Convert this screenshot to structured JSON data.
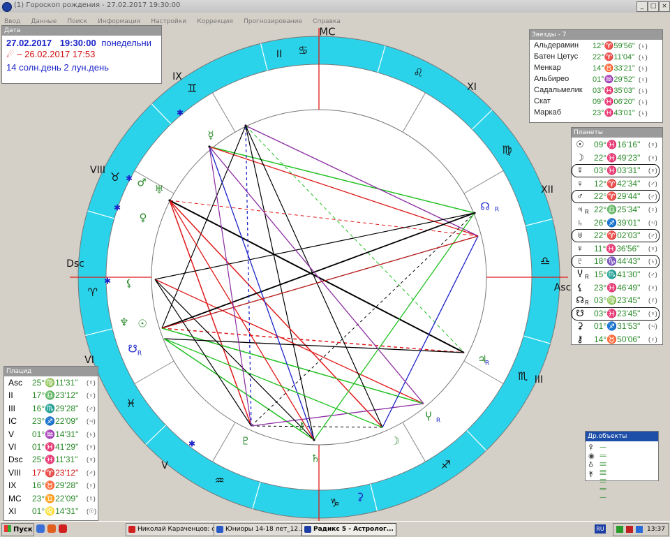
{
  "window": {
    "title": "(1) Гороскоп рождения - 27.02.2017  19:30:00",
    "minimize": "_",
    "maximize": "□",
    "close": "×"
  },
  "menu": [
    "Ввод",
    "Данные",
    "Поиск",
    "Информация",
    "Настройки",
    "Коррекция",
    "Прогнозирование",
    "Справка"
  ],
  "date_panel": {
    "header": "Дата",
    "date": "27.02.2017",
    "time": "19:30:00",
    "weekday": "понедельни",
    "progression_icon": "comet-icon",
    "progression": "– 26.02.2017  17:53",
    "days": "14 солн.день 2 лун.день"
  },
  "stars": {
    "header": "Звезды - 7",
    "items": [
      {
        "name": "Альдерамин",
        "value": "12°♈59'56\"",
        "ruler": "(♄)"
      },
      {
        "name": "Батен Цетус",
        "value": "22°♈11'04\"",
        "ruler": "(♄)"
      },
      {
        "name": "Менкар",
        "value": "14°♉33'21\"",
        "ruler": "(♄)"
      },
      {
        "name": "Альбирео",
        "value": "01°♒29'52\"",
        "ruler": "(♀)"
      },
      {
        "name": "Садальмелик",
        "value": "03°♓35'03\"",
        "ruler": "(♄)"
      },
      {
        "name": "Скат",
        "value": "09°♓06'20\"",
        "ruler": "(♄)"
      },
      {
        "name": "Маркаб",
        "value": "23°♓43'01\"",
        "ruler": "(♄)"
      }
    ]
  },
  "planets": {
    "header": "Планеты",
    "items": [
      {
        "glyph": "☉",
        "value": "09°♓16'16\"",
        "ruler": "(♆)",
        "retro": "",
        "boxed": false,
        "red": false
      },
      {
        "glyph": "☽",
        "value": "22°♓49'23\"",
        "ruler": "(♆)",
        "retro": "",
        "boxed": false,
        "red": false
      },
      {
        "glyph": "☿",
        "value": "03°♓03'31\"",
        "ruler": "(♆)",
        "retro": "",
        "boxed": true,
        "red": false
      },
      {
        "glyph": "♀",
        "value": "12°♈42'34\"",
        "ruler": "(♂)",
        "retro": "",
        "boxed": false,
        "red": false
      },
      {
        "glyph": "♂",
        "value": "22°♈29'44\"",
        "ruler": "(♂)",
        "retro": "",
        "boxed": true,
        "red": false
      },
      {
        "glyph": "♃",
        "value": "22°♎25'34\"",
        "ruler": "(♀)",
        "retro": "R",
        "boxed": false,
        "red": false
      },
      {
        "glyph": "♄",
        "value": "26°♐39'01\"",
        "ruler": "(♃)",
        "retro": "",
        "boxed": false,
        "red": false
      },
      {
        "glyph": "♅",
        "value": "22°♈02'03\"",
        "ruler": "(♂)",
        "retro": "",
        "boxed": true,
        "red": false
      },
      {
        "glyph": "♆",
        "value": "11°♓36'56\"",
        "ruler": "(♆)",
        "retro": "",
        "boxed": false,
        "red": false
      },
      {
        "glyph": "♇",
        "value": "18°♑44'43\"",
        "ruler": "(♄)",
        "retro": "",
        "boxed": true,
        "red": false
      },
      {
        "glyph": "Ⴤ",
        "value": "15°♏41'30\"",
        "ruler": "(♂)",
        "retro": "R",
        "boxed": false,
        "red": false
      },
      {
        "glyph": "⚸",
        "value": "23°♓46'49\"",
        "ruler": "(♆)",
        "retro": "",
        "boxed": false,
        "red": false
      },
      {
        "glyph": "☊",
        "value": "03°♍23'45\"",
        "ruler": "(☿)",
        "retro": "R",
        "boxed": false,
        "red": false
      },
      {
        "glyph": "☋",
        "value": "03°♓23'45\"",
        "ruler": "(♆)",
        "retro": "",
        "boxed": true,
        "red": false
      },
      {
        "glyph": "⚳",
        "value": "01°♐31'53\"",
        "ruler": "(♃)",
        "retro": "",
        "boxed": false,
        "red": false
      },
      {
        "glyph": "⚷",
        "value": "14°♉50'06\"",
        "ruler": "(♀)",
        "retro": "",
        "boxed": false,
        "red": false
      }
    ]
  },
  "houses": {
    "header": "Плацид",
    "items": [
      {
        "key": "Asc",
        "value": "25°♍11'31\"",
        "ruler": "(☿)",
        "red": false
      },
      {
        "key": "II",
        "value": "17°♎23'12\"",
        "ruler": "(♀)",
        "red": false
      },
      {
        "key": "III",
        "value": "16°♏29'28\"",
        "ruler": "(♂)",
        "red": false
      },
      {
        "key": "IC",
        "value": "23°♐22'09\"",
        "ruler": "(♃)",
        "red": false
      },
      {
        "key": "V",
        "value": "01°♒14'31\"",
        "ruler": "(♄)",
        "red": false
      },
      {
        "key": "VI",
        "value": "01°♓41'29\"",
        "ruler": "(♆)",
        "red": false
      },
      {
        "key": "Dsc",
        "value": "25°♓11'31\"",
        "ruler": "(♆)",
        "red": false
      },
      {
        "key": "VIII",
        "value": "17°♈23'12\"",
        "ruler": "(♂)",
        "red": true
      },
      {
        "key": "IX",
        "value": "16°♉29'28\"",
        "ruler": "(♀)",
        "red": false
      },
      {
        "key": "MC",
        "value": "23°♊22'09\"",
        "ruler": "(☿)",
        "red": false
      },
      {
        "key": "XI",
        "value": "01°♌14'31\"",
        "ruler": "(☉)",
        "red": false
      }
    ]
  },
  "other_objects": {
    "header": "Др.объекты",
    "items": [
      {
        "glyph": "⚴",
        "dash": "— — — —"
      },
      {
        "glyph": "◉",
        "dash": "— — — —"
      },
      {
        "glyph": "♁",
        "dash": "— — — —"
      },
      {
        "glyph": "⚵",
        "dash": "— — — —"
      }
    ]
  },
  "chart_axes": {
    "mc": "MC",
    "ic": "IC",
    "asc": "Asc",
    "dsc": "Dsc"
  },
  "house_numbers": [
    "II",
    "III",
    "V",
    "VI",
    "VIII",
    "IX",
    "XI",
    "XII"
  ],
  "zodiac": [
    "♈",
    "♉",
    "♊",
    "♋",
    "♌",
    "♍",
    "♎",
    "♏",
    "♐",
    "♑",
    "♒",
    "♓"
  ],
  "chart_planet_glyphs": [
    {
      "glyph": "♅",
      "color": "#2a8a2a"
    },
    {
      "glyph": "♂",
      "color": "#2a8a2a"
    },
    {
      "glyph": "♀",
      "color": "#2a8a2a"
    },
    {
      "glyph": "⚸",
      "color": "#2a8a2a"
    },
    {
      "glyph": "♆",
      "color": "#2a8a2a"
    },
    {
      "glyph": "☉",
      "color": "#2a8a2a"
    },
    {
      "glyph": "☋",
      "color": "#1b23c8"
    },
    {
      "glyph": "☿",
      "color": "#2a8a2a"
    },
    {
      "glyph": "⚷",
      "color": "#2a8a2a"
    },
    {
      "glyph": "☊",
      "color": "#1b23c8"
    },
    {
      "glyph": "♃",
      "color": "#2a8a2a"
    },
    {
      "glyph": "Ⴤ",
      "color": "#2a8a2a"
    },
    {
      "glyph": "⚳",
      "color": "#1b23c8"
    },
    {
      "glyph": "♄",
      "color": "#2a8a2a"
    },
    {
      "glyph": "♇",
      "color": "#2a8a2a"
    },
    {
      "glyph": "☽",
      "color": "#2a8a2a"
    }
  ],
  "retro_mark": "R",
  "colors": {
    "ring": "#2bd3ea",
    "aspect_red": "#e01818",
    "aspect_green": "#20c020",
    "aspect_blue": "#1b23c8",
    "aspect_black": "#000000",
    "aspect_purple": "#8a2ba0"
  },
  "taskbar": {
    "start": "Пуск",
    "tasks": [
      "Николай Караченцов: с...",
      "Юниоры 14-18 лет_12....",
      "Радикс 5 - Астролог..."
    ],
    "lang": "RU",
    "clock": "13:37"
  }
}
